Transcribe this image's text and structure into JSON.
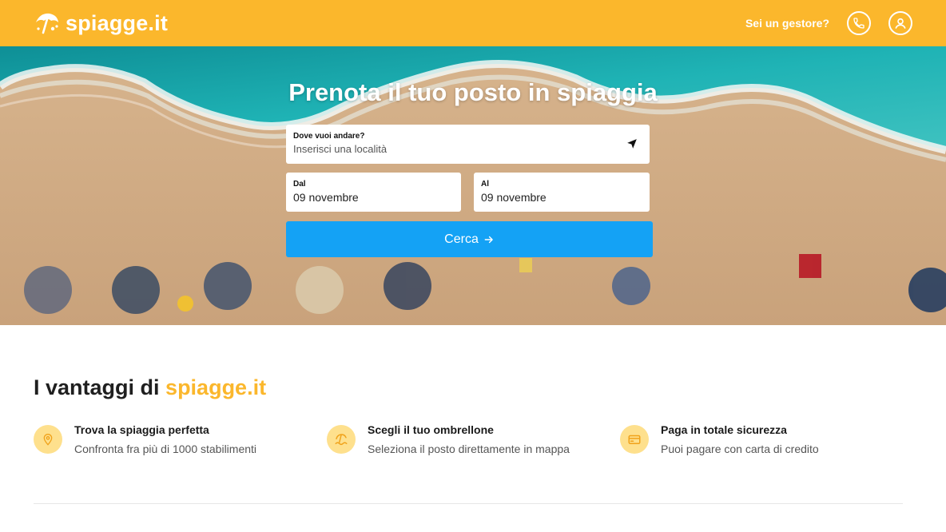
{
  "header": {
    "logo_text": "spiagge.it",
    "manager_link": "Sei un gestore?",
    "phone_icon": "phone-icon",
    "user_icon": "user-circle-icon",
    "background_color": "#fbb72c"
  },
  "hero": {
    "title": "Prenota il tuo posto in spiaggia",
    "destination": {
      "label": "Dove vuoi andare?",
      "placeholder": "Inserisci una località",
      "icon": "location-arrow-icon"
    },
    "date_from": {
      "label": "Dal",
      "value": "09 novembre"
    },
    "date_to": {
      "label": "Al",
      "value": "09 novembre"
    },
    "search_button": {
      "label": "Cerca",
      "icon": "arrow-right-icon",
      "color": "#14a2f5"
    }
  },
  "advantages": {
    "title_prefix": "I vantaggi di",
    "title_brand": "spiagge.it",
    "brand_color": "#fbb72c",
    "items": [
      {
        "icon": "map-pin-icon",
        "title": "Trova la spiaggia perfetta",
        "description": "Confronta fra più di 1000 stabilimenti"
      },
      {
        "icon": "umbrella-wave-icon",
        "title": "Scegli il tuo ombrellone",
        "description": "Seleziona il posto direttamente in mappa"
      },
      {
        "icon": "credit-card-icon",
        "title": "Paga in totale sicurezza",
        "description": "Puoi pagare con carta di credito"
      }
    ]
  }
}
